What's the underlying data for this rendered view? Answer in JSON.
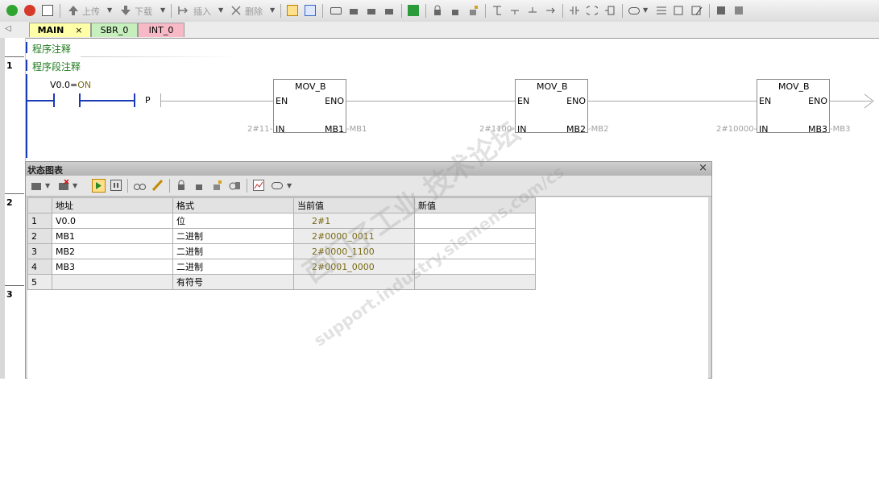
{
  "toolbar": {
    "upload_label": "上传",
    "download_label": "下载",
    "insert_label": "插入",
    "delete_label": "删除"
  },
  "tabs": [
    {
      "label": "MAIN",
      "active": true,
      "close": "×"
    },
    {
      "label": "SBR_0",
      "color": "#c6efbd"
    },
    {
      "label": "INT_0",
      "color": "#f7b9c6"
    }
  ],
  "editor": {
    "program_comment": "程序注释",
    "network_comment": "程序段注释",
    "networks": [
      "1",
      "2",
      "3"
    ],
    "contact_label": "V0.0=",
    "contact_state": "ON",
    "pulse_label": "P",
    "blocks": [
      {
        "title": "MOV_B",
        "en": "EN",
        "eno": "ENO",
        "in": "IN",
        "out": "MB1",
        "in_value": "2#11",
        "out_value": "MB1"
      },
      {
        "title": "MOV_B",
        "en": "EN",
        "eno": "ENO",
        "in": "IN",
        "out": "MB2",
        "in_value": "2#1100",
        "out_value": "MB2"
      },
      {
        "title": "MOV_B",
        "en": "EN",
        "eno": "ENO",
        "in": "IN",
        "out": "MB3",
        "in_value": "2#10000",
        "out_value": "MB3"
      }
    ]
  },
  "status_chart": {
    "title": "状态图表",
    "close": "×",
    "headers": [
      "地址",
      "格式",
      "当前值",
      "新值"
    ],
    "rows": [
      {
        "n": "1",
        "address": "V0.0",
        "format": "位",
        "current": "2#1",
        "new": ""
      },
      {
        "n": "2",
        "address": "MB1",
        "format": "二进制",
        "current": "2#0000_0011",
        "new": ""
      },
      {
        "n": "3",
        "address": "MB2",
        "format": "二进制",
        "current": "2#0000_1100",
        "new": ""
      },
      {
        "n": "4",
        "address": "MB3",
        "format": "二进制",
        "current": "2#0001_0000",
        "new": ""
      },
      {
        "n": "5",
        "address": "",
        "format": "有符号",
        "current": "",
        "new": ""
      }
    ]
  },
  "watermark": {
    "cn": "西门子工业 技术论坛",
    "url": "support.industry.siemens.com/cs"
  },
  "colors": {
    "rail": "#1a3bb8",
    "comment": "#1f7a1f",
    "current_value": "#7a6a14"
  }
}
